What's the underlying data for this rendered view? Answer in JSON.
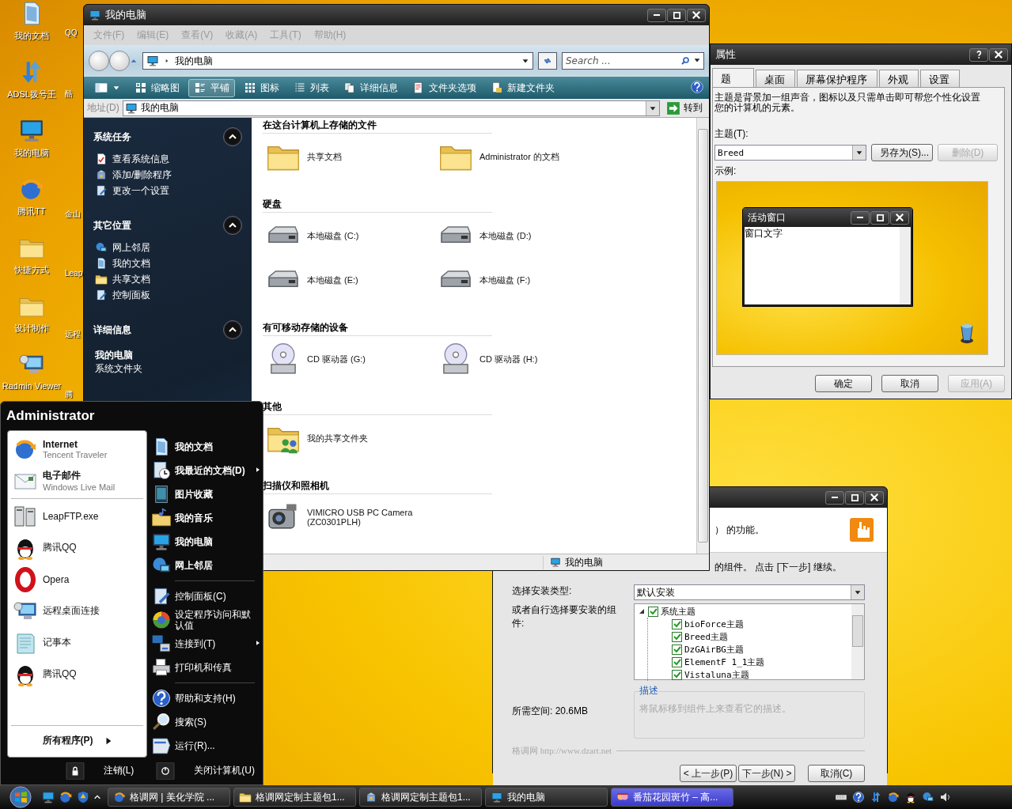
{
  "desktop_icons": [
    {
      "label": "我的文档"
    },
    {
      "label": "ADSL拨号王"
    },
    {
      "label": "我的电脑"
    },
    {
      "label": "腾讯TT"
    },
    {
      "label": "快捷方式"
    },
    {
      "label": "设计制作"
    },
    {
      "label": "Radmin Viewer"
    }
  ],
  "desktop_labels_behind": [
    {
      "label": "QQ"
    },
    {
      "label": "酷"
    },
    {
      "label": "金山"
    },
    {
      "label": "Leap"
    },
    {
      "label": "远程"
    },
    {
      "label": "腾"
    }
  ],
  "explorer": {
    "title": "我的电脑",
    "menu": [
      {
        "label": "文件(F)",
        "disabled": true
      },
      {
        "label": "编辑(E)",
        "disabled": true
      },
      {
        "label": "查看(V)",
        "disabled": true
      },
      {
        "label": "收藏(A)",
        "disabled": true
      },
      {
        "label": "工具(T)",
        "disabled": true
      },
      {
        "label": "帮助(H)",
        "disabled": true
      }
    ],
    "breadcrumb": "我的电脑",
    "search": {
      "placeholder": "Search ..."
    },
    "toolbar": [
      {
        "label": "缩略图",
        "selected": false
      },
      {
        "label": "平铺",
        "selected": true
      },
      {
        "label": "图标",
        "selected": false
      },
      {
        "label": "列表",
        "selected": false
      },
      {
        "label": "详细信息",
        "selected": false
      },
      {
        "label": "文件夹选项",
        "selected": false
      },
      {
        "label": "新建文件夹",
        "selected": false
      }
    ],
    "address": {
      "label": "地址(D)",
      "value": "我的电脑",
      "go": "转到"
    },
    "panels": [
      {
        "title": "系统任务",
        "expanded": true,
        "items": [
          "查看系统信息",
          "添加/删除程序",
          "更改一个设置"
        ]
      },
      {
        "title": "其它位置",
        "expanded": true,
        "items": [
          "网上邻居",
          "我的文档",
          "共享文档",
          "控制面板"
        ]
      },
      {
        "title": "详细信息",
        "expanded": true,
        "detail_name": "我的电脑",
        "detail_type": "系统文件夹"
      }
    ],
    "groups": [
      {
        "title": "在这台计算机上存储的文件",
        "items": [
          {
            "kind": "folder",
            "label": "共享文档"
          },
          {
            "kind": "folder",
            "label": "Administrator 的文档"
          }
        ]
      },
      {
        "title": "硬盘",
        "items": [
          {
            "kind": "drive",
            "label": "本地磁盘 (C:)"
          },
          {
            "kind": "drive",
            "label": "本地磁盘 (D:)"
          },
          {
            "kind": "drive",
            "label": "本地磁盘 (E:)"
          },
          {
            "kind": "drive",
            "label": "本地磁盘 (F:)"
          }
        ]
      },
      {
        "title": "有可移动存储的设备",
        "items": [
          {
            "kind": "cd",
            "label": "CD 驱动器 (G:)"
          },
          {
            "kind": "cd",
            "label": "CD 驱动器 (H:)"
          }
        ]
      },
      {
        "title": "其他",
        "items": [
          {
            "kind": "shared",
            "label": "我的共享文件夹"
          }
        ]
      },
      {
        "title": "扫描仪和照相机",
        "items": [
          {
            "kind": "camera",
            "label": "VIMICRO USB PC Camera (ZC0301PLH)"
          }
        ]
      }
    ],
    "status": "我的电脑"
  },
  "properties": {
    "title": "属性",
    "tabs": [
      {
        "label": "题",
        "selected": true
      },
      {
        "label": "桌面",
        "selected": false
      },
      {
        "label": "屏幕保护程序",
        "selected": false
      },
      {
        "label": "外观",
        "selected": false
      },
      {
        "label": "设置",
        "selected": false
      }
    ],
    "description_lines": [
      "主题是背景加一组声音，图标以及只需单击即可帮您个性化设置",
      "您的计算机的元素。"
    ],
    "theme_label": "主题(T):",
    "theme_value": "Breed",
    "theme_buttons": [
      {
        "label": "另存为(S)...",
        "disabled": false
      },
      {
        "label": "删除(D)",
        "disabled": true
      }
    ],
    "sample_label": "示例:",
    "preview": {
      "title": "活动窗口",
      "text": "窗口文字"
    },
    "buttons": [
      {
        "label": "确定",
        "disabled": false
      },
      {
        "label": "取消",
        "disabled": false
      },
      {
        "label": "应用(A)",
        "disabled": true
      }
    ]
  },
  "installer": {
    "header": "） 的功能。",
    "subtitle": "的组件。 点击 [下一步] 继续。",
    "type_label": "选择安装类型:",
    "type_value": "默认安装",
    "components_label": "或者自行选择要安装的组件:",
    "tree": [
      {
        "label": "系统主题",
        "checked": true,
        "expanded": true,
        "children": [
          {
            "label": "bioForce主题",
            "checked": true
          },
          {
            "label": "Breed主题",
            "checked": true
          },
          {
            "label": "DzGAirBG主题",
            "checked": true
          },
          {
            "label": "ElementF 1_1主题",
            "checked": true
          },
          {
            "label": "Vistaluna主题",
            "checked": true
          }
        ]
      }
    ],
    "description_title": "描述",
    "description": "将鼠标移到组件上来查看它的描述。",
    "space": "所需空间: 20.6MB",
    "brand": "格调网 http://www.dzart.net",
    "buttons": [
      {
        "label": "< 上一步(P)",
        "disabled": false
      },
      {
        "label": "下一步(N) >",
        "disabled": false
      },
      {
        "label": "取消(C)",
        "disabled": false
      }
    ]
  },
  "start_menu": {
    "user": "Administrator",
    "pinned": [
      {
        "title": "Internet",
        "subtitle": "Tencent Traveler"
      },
      {
        "title": "电子邮件",
        "subtitle": "Windows Live Mail"
      }
    ],
    "recent": [
      "LeapFTP.exe",
      "腾讯QQ",
      "Opera",
      "远程桌面连接",
      "记事本",
      "腾讯QQ"
    ],
    "all_programs": "所有程序(P)",
    "places": [
      {
        "label": "我的文档",
        "submenu": false
      },
      {
        "label": "我最近的文档(D)",
        "submenu": true
      },
      {
        "label": "图片收藏",
        "submenu": false
      },
      {
        "label": "我的音乐",
        "submenu": false
      },
      {
        "label": "我的电脑",
        "submenu": false
      },
      {
        "label": "网上邻居",
        "submenu": false
      }
    ],
    "system": [
      {
        "label": "控制面板(C)",
        "submenu": false
      },
      {
        "label": "设定程序访问和默认值",
        "submenu": false
      },
      {
        "label": "连接到(T)",
        "submenu": true
      },
      {
        "label": "打印机和传真",
        "submenu": false
      }
    ],
    "help": [
      {
        "label": "帮助和支持(H)",
        "submenu": false
      },
      {
        "label": "搜索(S)",
        "submenu": false
      },
      {
        "label": "运行(R)...",
        "submenu": false
      }
    ],
    "log_off": "注销(L)",
    "shut_down": "关闭计算机(U)"
  },
  "taskbar": {
    "tasks": [
      {
        "label": "格调网 | 美化学院 ...",
        "selected": false
      },
      {
        "label": "格调网定制主题包1...",
        "selected": false
      },
      {
        "label": "格调网定制主题包1...",
        "selected": false
      },
      {
        "label": "我的电脑",
        "selected": false
      },
      {
        "label": "番茄花园斑竹 – 高...",
        "selected": true
      }
    ]
  }
}
